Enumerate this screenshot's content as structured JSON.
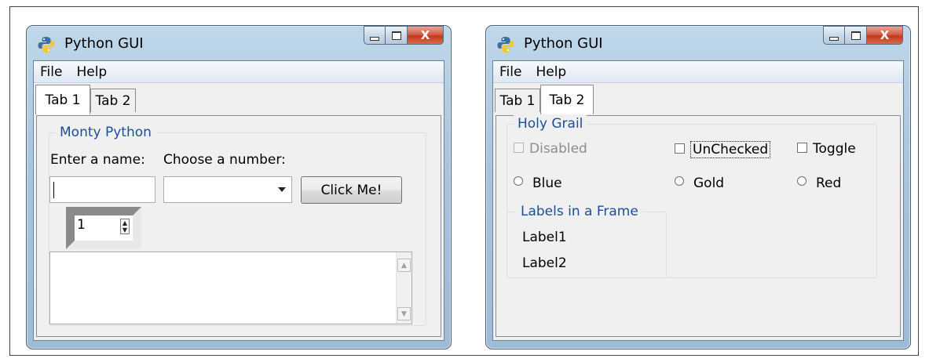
{
  "windows": [
    {
      "title": "Python GUI",
      "menu": [
        "File",
        "Help"
      ],
      "tabs": [
        "Tab 1",
        "Tab 2"
      ],
      "active_tab": "Tab 1",
      "caption_buttons": {
        "minimize": "minimize-icon",
        "maximize": "maximize-icon",
        "close": "X"
      },
      "group": {
        "title": "Monty Python",
        "name_label": "Enter a name:",
        "number_label": "Choose a number:",
        "name_value": "",
        "number_value": "",
        "button_label": "Click Me!",
        "spinbox_value": "1",
        "scrolled_text": ""
      }
    },
    {
      "title": "Python GUI",
      "menu": [
        "File",
        "Help"
      ],
      "tabs": [
        "Tab 1",
        "Tab 2"
      ],
      "active_tab": "Tab 2",
      "caption_buttons": {
        "minimize": "minimize-icon",
        "maximize": "maximize-icon",
        "close": "X"
      },
      "group": {
        "title": "Holy Grail",
        "checkboxes": [
          {
            "label": "Disabled",
            "checked": false,
            "enabled": false
          },
          {
            "label": "UnChecked",
            "checked": false,
            "enabled": true
          },
          {
            "label": "Toggle",
            "checked": false,
            "enabled": true
          }
        ],
        "radios": [
          {
            "label": "Blue",
            "selected": false
          },
          {
            "label": "Gold",
            "selected": false
          },
          {
            "label": "Red",
            "selected": false
          }
        ],
        "labels_frame": {
          "title": "Labels in a Frame",
          "labels": [
            "Label1",
            "Label2"
          ]
        }
      }
    }
  ],
  "colors": {
    "group_title": "#1c4e9b",
    "close_button": "#c9462a",
    "title_bar": "#a9c6df"
  }
}
